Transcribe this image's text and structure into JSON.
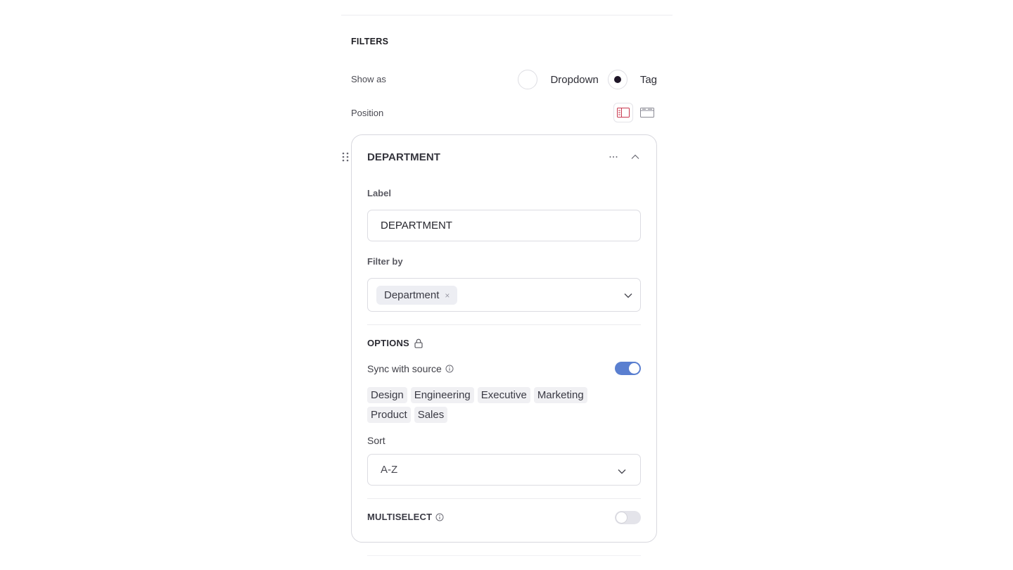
{
  "filters": {
    "section_title": "FILTERS",
    "show_as": {
      "label": "Show as",
      "options": [
        {
          "label": "Dropdown",
          "selected": false
        },
        {
          "label": "Tag",
          "selected": true
        }
      ]
    },
    "position": {
      "label": "Position",
      "options": [
        {
          "icon": "sidebar-layout-icon",
          "selected": true
        },
        {
          "icon": "top-bar-layout-icon",
          "selected": false
        }
      ]
    }
  },
  "filter_card": {
    "title": "DEPARTMENT",
    "more_icon": "ellipsis-icon",
    "collapse_icon": "chevron-up-icon",
    "label_field": {
      "label": "Label",
      "value": "DEPARTMENT"
    },
    "filter_by": {
      "label": "Filter by",
      "chips": [
        "Department"
      ],
      "remove_glyph": "×"
    },
    "options": {
      "title": "OPTIONS",
      "sync_label": "Sync with source",
      "sync_enabled": true,
      "values": [
        "Design",
        "Engineering",
        "Executive",
        "Marketing",
        "Product",
        "Sales"
      ]
    },
    "sort": {
      "label": "Sort",
      "value": "A-Z"
    },
    "multiselect": {
      "label": "MULTISELECT",
      "enabled": false
    }
  },
  "colors": {
    "accent_toggle": "#5a7fd0",
    "radio_selected": "#1e1527",
    "position_active": "#c8374e"
  }
}
